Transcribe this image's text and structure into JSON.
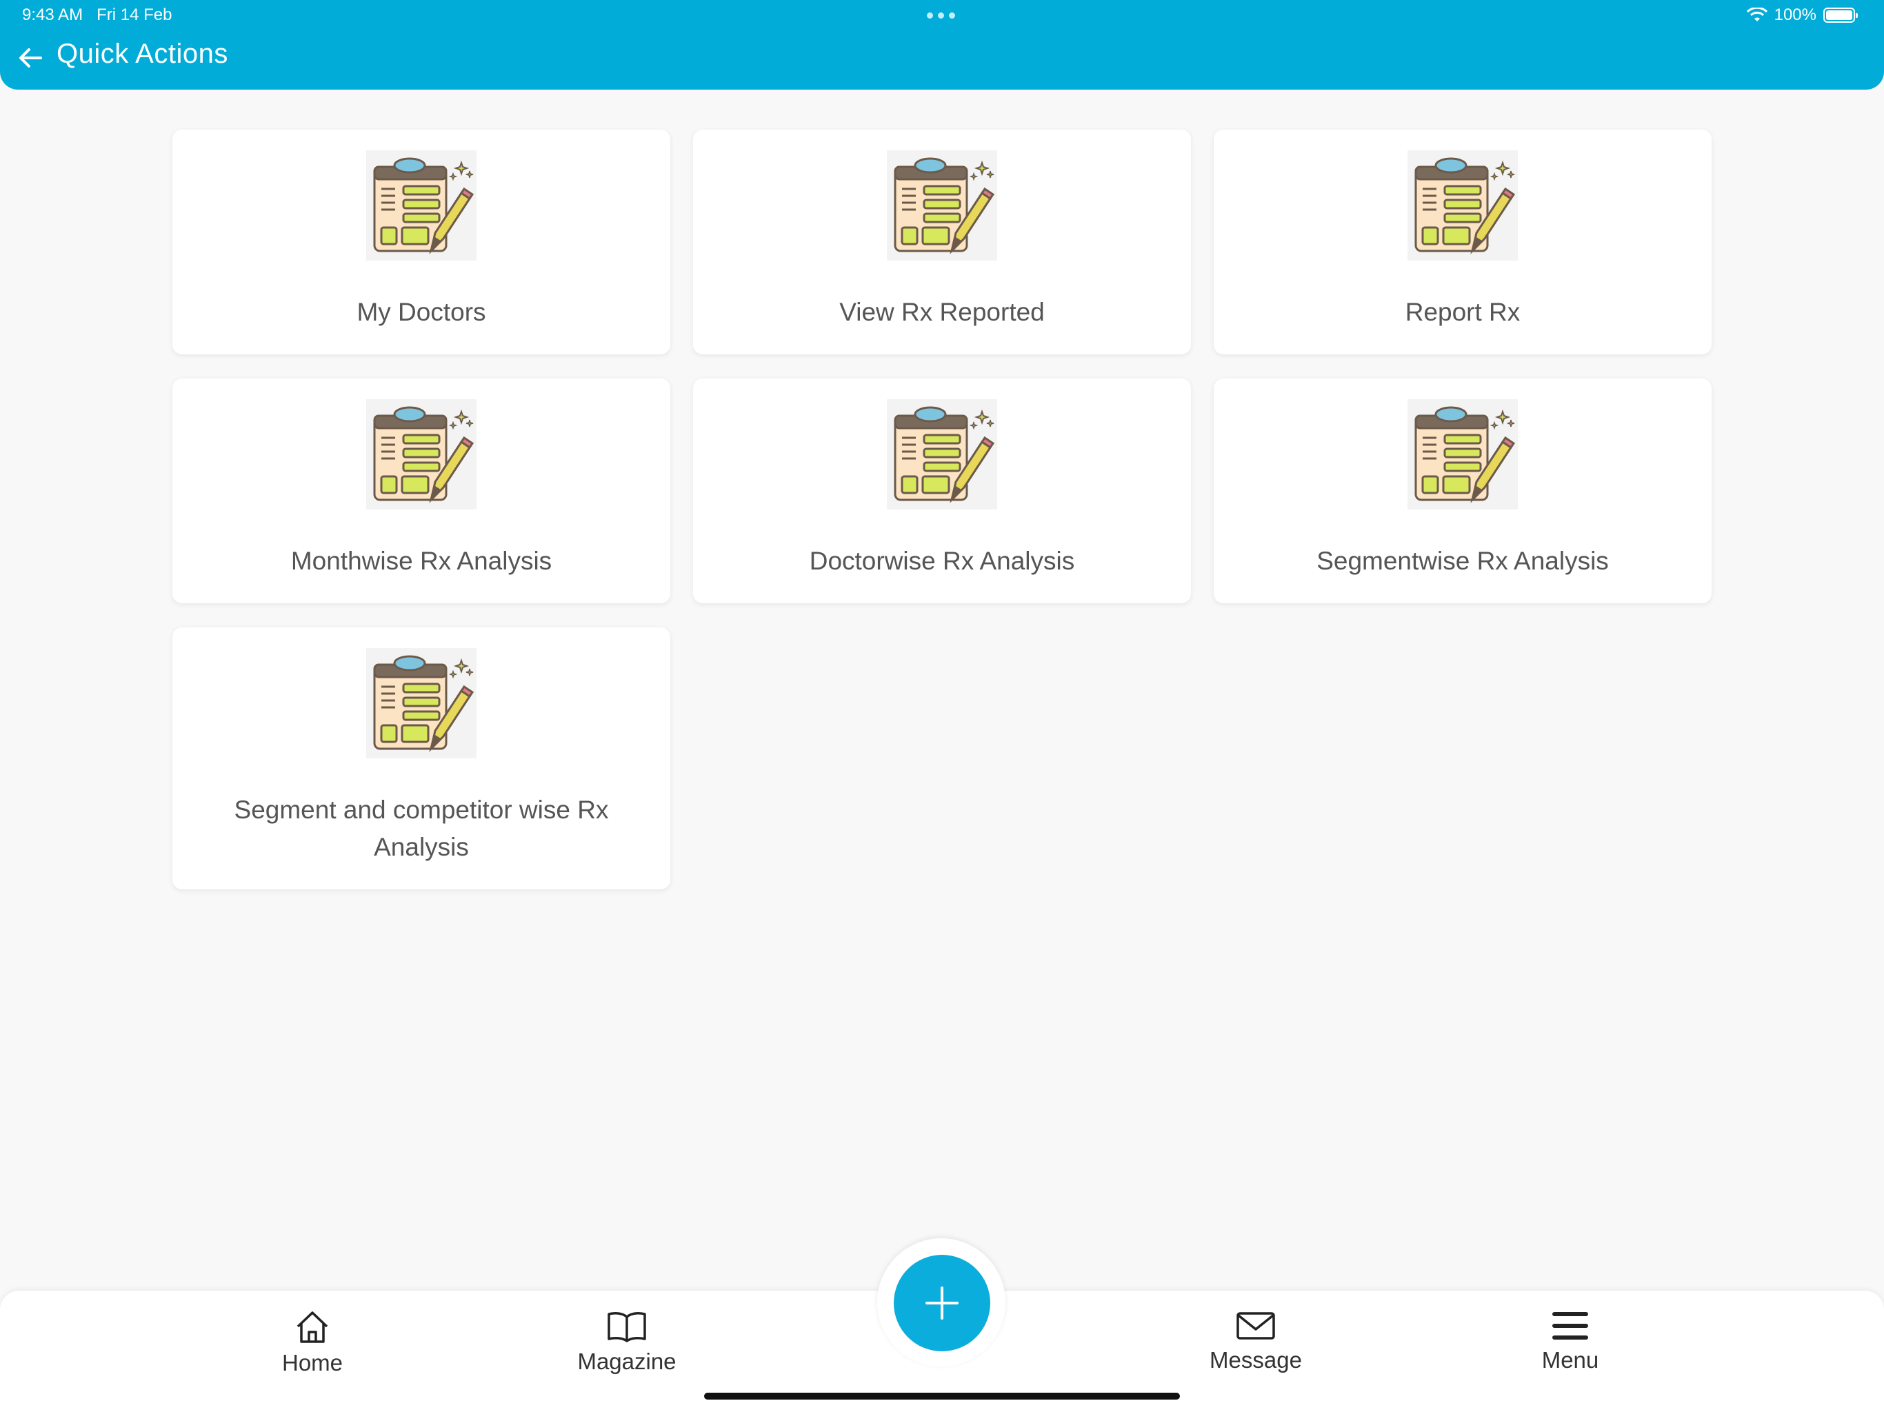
{
  "status_bar": {
    "time": "9:43 AM",
    "date": "Fri 14 Feb",
    "battery": "100%"
  },
  "header": {
    "title": "Quick Actions",
    "back_icon": "arrow-left-icon"
  },
  "actions": [
    {
      "label": "My Doctors",
      "icon": "clipboard-pencil-icon"
    },
    {
      "label": "View Rx Reported",
      "icon": "clipboard-pencil-icon"
    },
    {
      "label": "Report Rx",
      "icon": "clipboard-pencil-icon"
    },
    {
      "label": "Monthwise Rx Analysis",
      "icon": "clipboard-pencil-icon"
    },
    {
      "label": "Doctorwise Rx Analysis",
      "icon": "clipboard-pencil-icon"
    },
    {
      "label": "Segmentwise Rx Analysis",
      "icon": "clipboard-pencil-icon"
    },
    {
      "label": "Segment and competitor wise Rx Analysis",
      "icon": "clipboard-pencil-icon"
    }
  ],
  "bottom_nav": {
    "home": "Home",
    "magazine": "Magazine",
    "message": "Message",
    "menu": "Menu",
    "fab_icon": "plus-icon"
  },
  "colors": {
    "accent": "#02acd8",
    "background": "#f8f8f8",
    "card": "#ffffff",
    "text": "#555555"
  }
}
